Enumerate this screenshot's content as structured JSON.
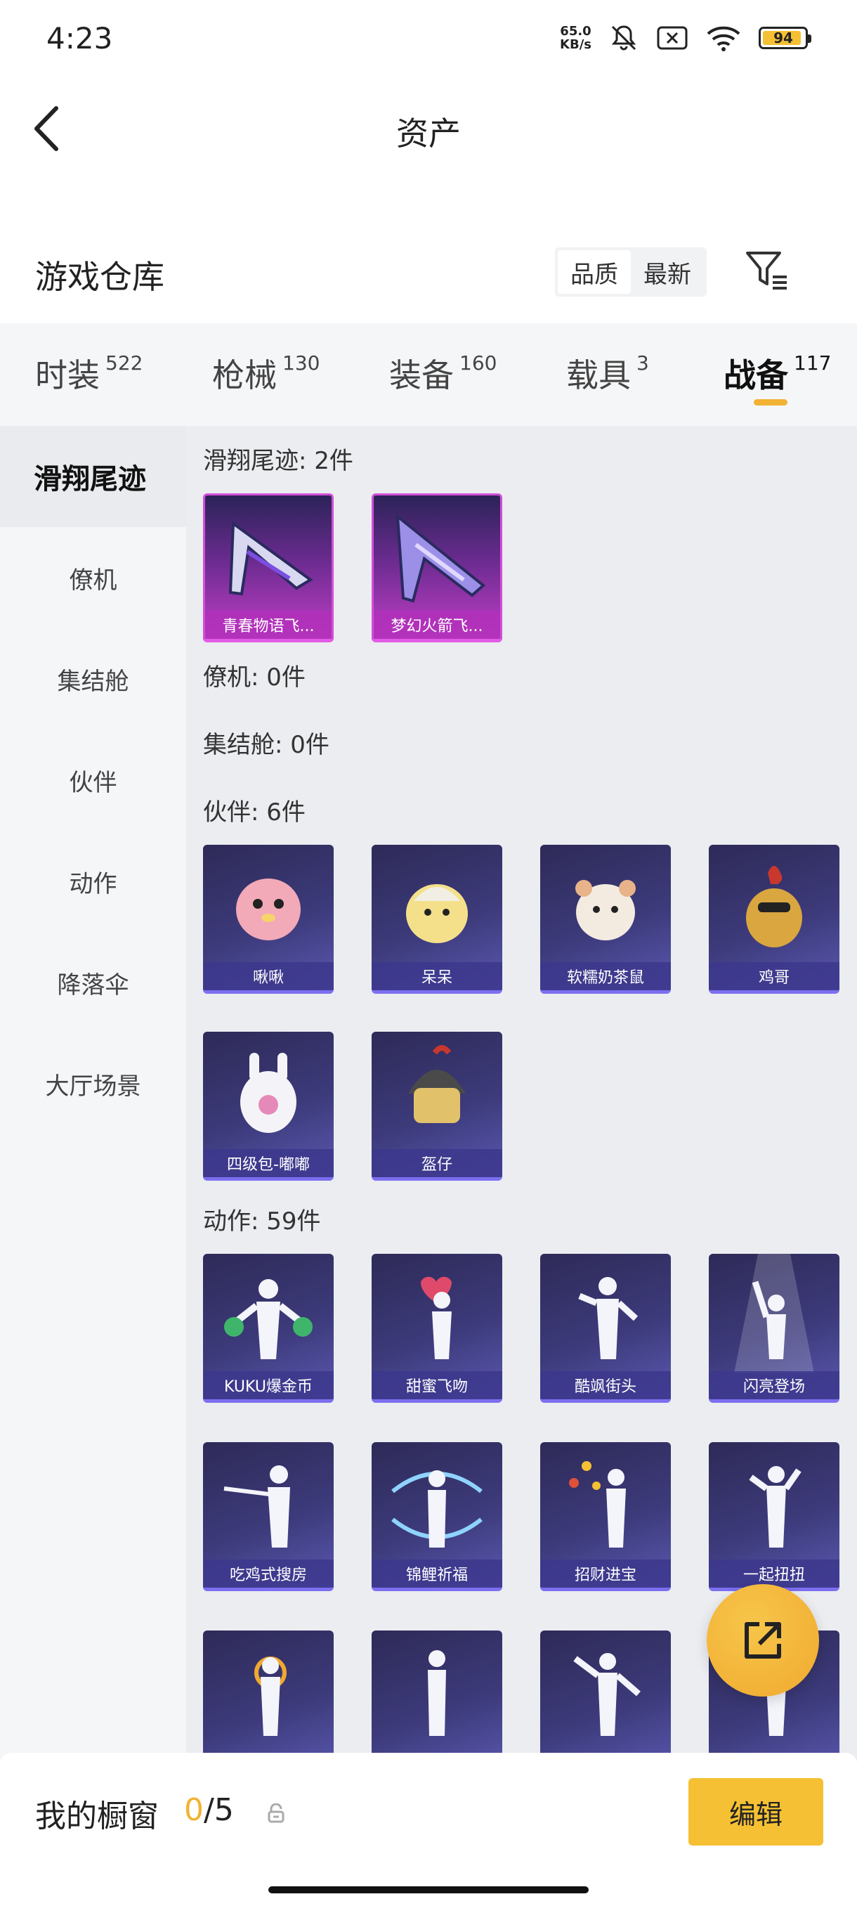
{
  "status": {
    "time": "4:23",
    "netspeed_value": "65.0",
    "netspeed_unit": "KB/s",
    "battery": "94"
  },
  "header": {
    "title": "资产"
  },
  "warehouse": {
    "title": "游戏仓库",
    "sort_options": [
      "品质",
      "最新"
    ]
  },
  "tabs": [
    {
      "label": "时装",
      "count": "522"
    },
    {
      "label": "枪械",
      "count": "130"
    },
    {
      "label": "装备",
      "count": "160"
    },
    {
      "label": "载具",
      "count": "3"
    },
    {
      "label": "战备",
      "count": "117"
    }
  ],
  "sidebar": [
    "滑翔尾迹",
    "僚机",
    "集结舱",
    "伙伴",
    "动作",
    "降落伞",
    "大厅场景"
  ],
  "sections": {
    "glide": {
      "title": "滑翔尾迹: 2件",
      "items": [
        "青春物语飞...",
        "梦幻火箭飞..."
      ]
    },
    "wingman": {
      "title": "僚机: 0件"
    },
    "capsule": {
      "title": "集结舱: 0件"
    },
    "partner": {
      "title": "伙伴: 6件",
      "items": [
        "啾啾",
        "呆呆",
        "软糯奶茶鼠",
        "鸡哥",
        "四级包-嘟嘟",
        "盔仔"
      ]
    },
    "emote": {
      "title": "动作: 59件",
      "items": [
        "KUKU爆金币",
        "甜蜜飞吻",
        "酷飒街头",
        "闪亮登场",
        "吃鸡式搜房",
        "锦鲤祈福",
        "招财进宝",
        "一起扭扭"
      ]
    }
  },
  "bottom": {
    "label": "我的橱窗",
    "current": "0",
    "total": "/5",
    "edit": "编辑"
  },
  "colors": {
    "accent": "#f2b233",
    "card_blue": "#3c3a7a",
    "card_purple": "#c03ec5"
  }
}
